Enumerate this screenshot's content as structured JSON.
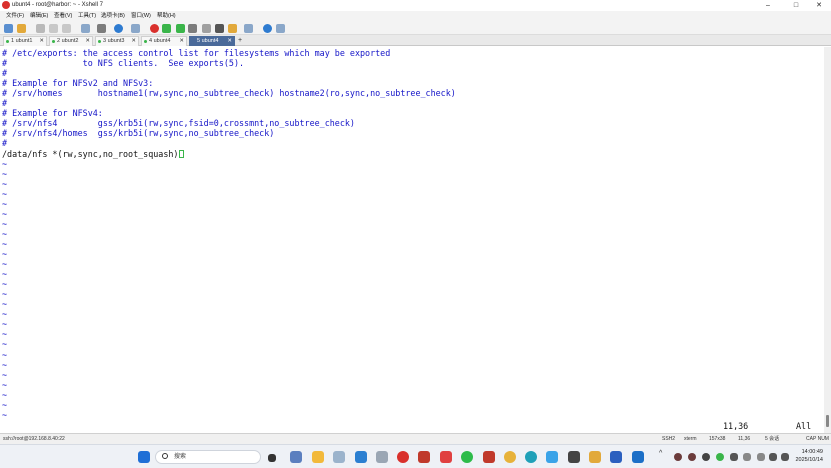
{
  "window": {
    "title": "ubunt4 - root@harbor: ~ - Xshell 7",
    "minimize": "–",
    "maximize": "□",
    "close": "✕"
  },
  "menu": [
    "文件(F)",
    "编辑(E)",
    "查看(V)",
    "工具(T)",
    "选项卡(B)",
    "窗口(W)",
    "帮助(H)"
  ],
  "tabs": [
    {
      "label": "1 ubunt1",
      "active": false
    },
    {
      "label": "2 ubunt2",
      "active": false
    },
    {
      "label": "3 ubunt3",
      "active": false
    },
    {
      "label": "4 ubunt4",
      "active": false
    },
    {
      "label": "5 ubunt4",
      "active": true
    }
  ],
  "tab_add": "+",
  "terminal": {
    "lines": [
      {
        "text": "# /etc/exports: the access control list for filesystems which may be exported",
        "kind": "comment"
      },
      {
        "text": "#               to NFS clients.  See exports(5).",
        "kind": "comment"
      },
      {
        "text": "#",
        "kind": "comment"
      },
      {
        "text": "# Example for NFSv2 and NFSv3:",
        "kind": "comment"
      },
      {
        "text": "# /srv/homes       hostname1(rw,sync,no_subtree_check) hostname2(ro,sync,no_subtree_check)",
        "kind": "comment"
      },
      {
        "text": "#",
        "kind": "comment"
      },
      {
        "text": "# Example for NFSv4:",
        "kind": "comment"
      },
      {
        "text": "# /srv/nfs4        gss/krb5i(rw,sync,fsid=0,crossmnt,no_subtree_check)",
        "kind": "comment"
      },
      {
        "text": "# /srv/nfs4/homes  gss/krb5i(rw,sync,no_subtree_check)",
        "kind": "comment"
      },
      {
        "text": "#",
        "kind": "comment"
      },
      {
        "text": "/data/nfs *(rw,sync,no_root_squash)",
        "kind": "plain",
        "cursor": true
      }
    ],
    "tilde": "~",
    "tilde_count": 26,
    "position": "11,36",
    "scroll": "All"
  },
  "statusbar": {
    "connection": "ssh://root@192.168.8.40:22",
    "protocol": "SSH2",
    "term": "xterm",
    "size": "157x38",
    "cursor": "11,36",
    "sessions": "5 会话",
    "caps": "CAP NUM"
  },
  "taskbar": {
    "search_placeholder": "搜索",
    "time": "14:00:49",
    "date": "2025/10/14"
  },
  "colors": {
    "comment": "#1515c8",
    "active_tab": "#4a6a9a",
    "cursor": "#3ab54a"
  }
}
